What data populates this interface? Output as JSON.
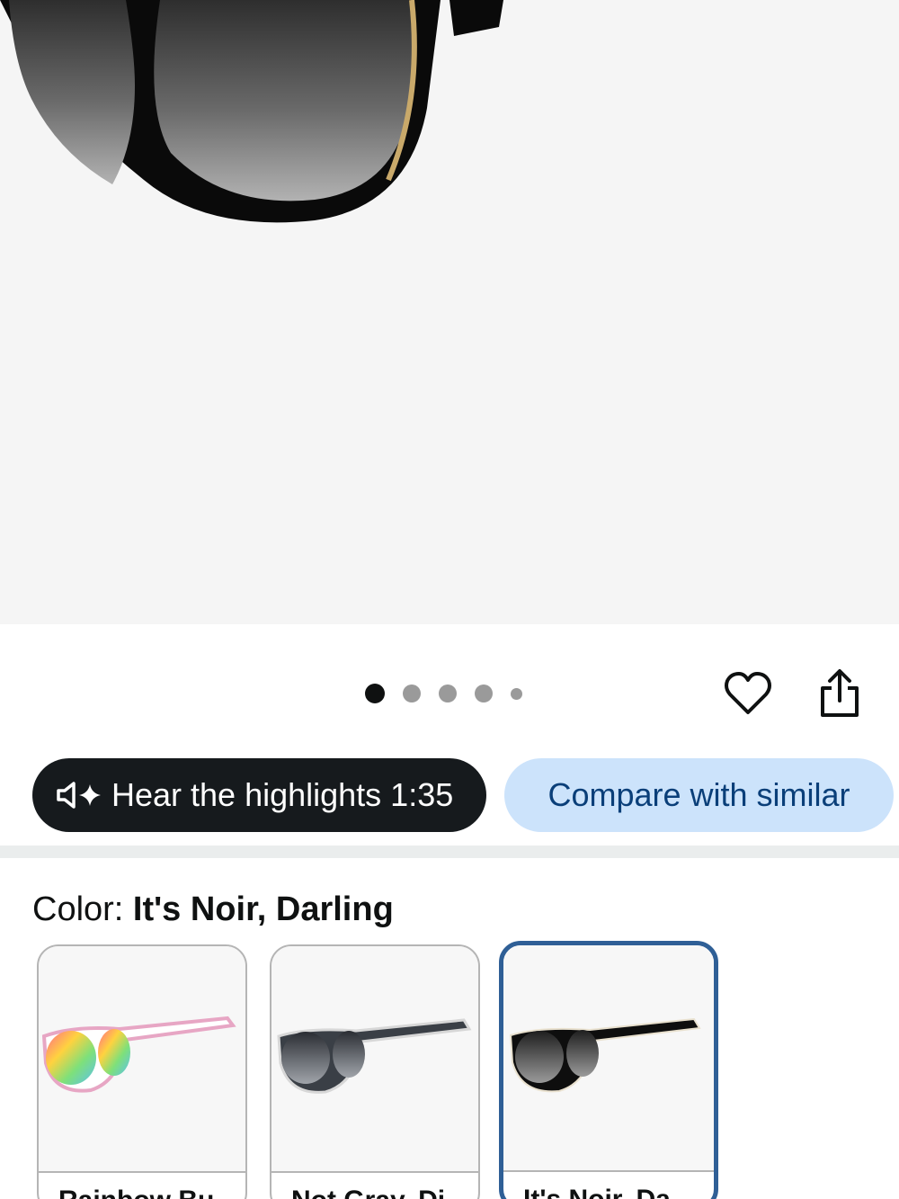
{
  "hero": {
    "image": "product-sunglasses-black-image",
    "pages": 5,
    "active_page": 1
  },
  "actions": {
    "wishlist_icon": "heart-icon",
    "share_icon": "share-icon"
  },
  "audio": {
    "label": "Hear the highlights 1:35",
    "icon": "speaker-sparkle-icon"
  },
  "compare": {
    "label": "Compare with similar"
  },
  "color": {
    "prefix": "Color: ",
    "selected": "It's Noir, Darling"
  },
  "swatches": [
    {
      "label": "Rainbow Bu",
      "image": "rainbow-sunglasses-thumb",
      "selected": false
    },
    {
      "label": "Not Gray, Di",
      "image": "gray-sunglasses-thumb",
      "selected": false
    },
    {
      "label": "It's Noir, Da",
      "image": "black-sunglasses-thumb",
      "selected": true
    }
  ],
  "colors": {
    "accent": "#2f5f96",
    "compare_bg": "#cce3fb",
    "compare_text": "#0a3f79",
    "audio_bg": "#161a1d"
  }
}
